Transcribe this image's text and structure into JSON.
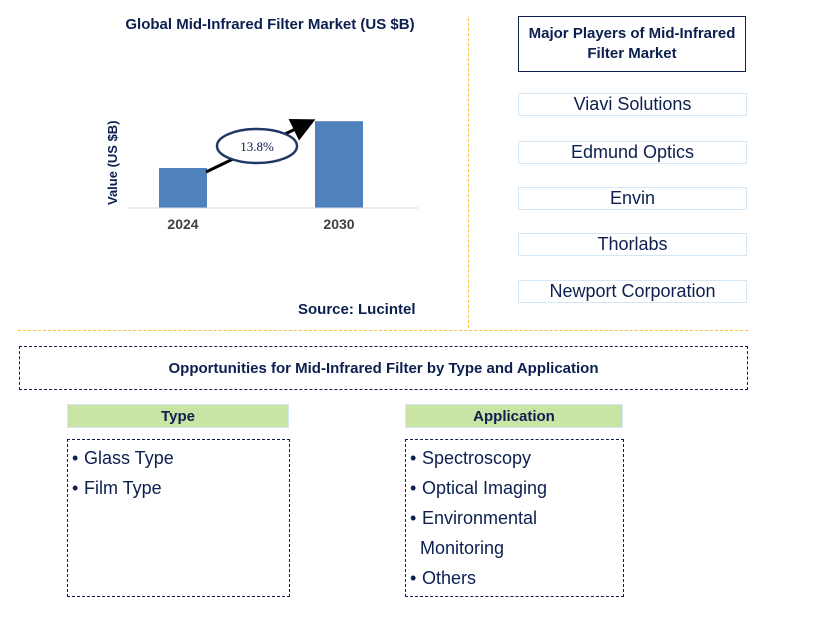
{
  "chart_data": {
    "type": "bar",
    "title": "Global Mid-Infrared Filter Market (US $B)",
    "xlabel": "",
    "ylabel": "Value (US $B)",
    "categories": [
      "2024",
      "2030"
    ],
    "values": [
      1.0,
      2.17
    ],
    "value_note": "relative values; no y-axis tick labels shown",
    "ylim": [
      0,
      2.3
    ],
    "grid": false,
    "legend": "none",
    "annotation": {
      "text": "13.8%",
      "meaning": "CAGR 2024-2030"
    },
    "colors": {
      "bar": "#4f81bd",
      "text": "#0c1f4f"
    }
  },
  "source": "Source: Lucintel",
  "players": {
    "title": "Major Players of Mid-Infrared Filter Market",
    "items": [
      "Viavi Solutions",
      "Edmund Optics",
      "Envin",
      "Thorlabs",
      "Newport Corporation"
    ]
  },
  "opportunities": {
    "title": "Opportunities for Mid-Infrared Filter by Type and Application",
    "type": {
      "header": "Type",
      "items": [
        "Glass Type",
        "Film Type"
      ]
    },
    "application": {
      "header": "Application",
      "items": [
        "Spectroscopy",
        "Optical Imaging",
        "Environmental",
        "Monitoring",
        "Others"
      ]
    }
  },
  "bullet": "•"
}
